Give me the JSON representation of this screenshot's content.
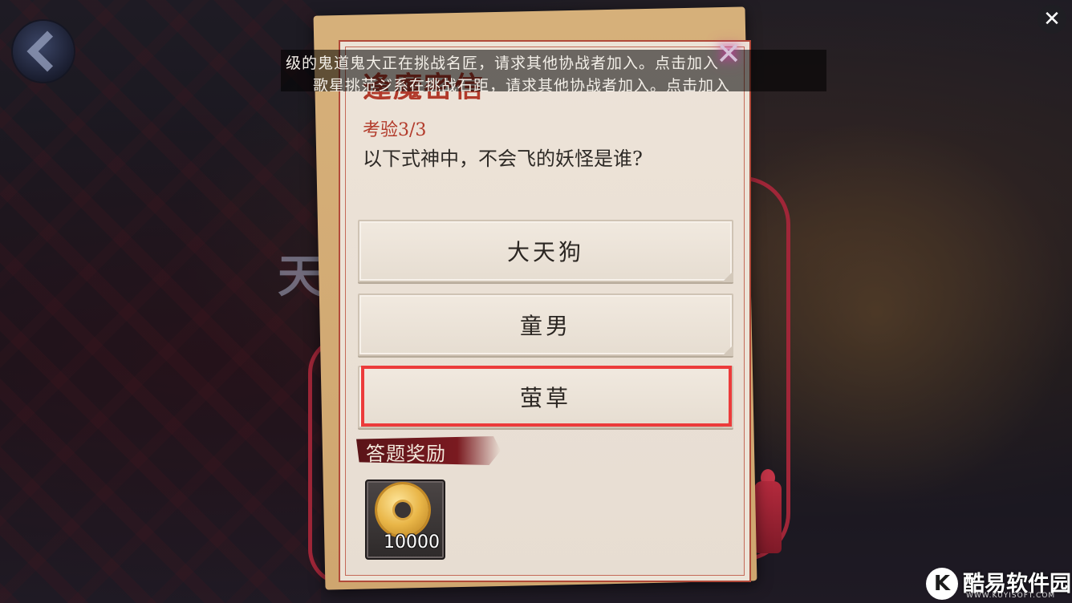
{
  "dialog": {
    "title": "逢魔密信",
    "round_label": "考验3/3",
    "question": "以下式神中，不会飞的妖怪是谁?",
    "options": [
      {
        "label": "大天狗"
      },
      {
        "label": "童男"
      },
      {
        "label": "萤草"
      }
    ],
    "highlighted_option_index": 2,
    "reward_section_label": "答题奖励",
    "reward": {
      "item_icon": "gold-coin-icon",
      "count": "10000"
    }
  },
  "notification": {
    "line1": "级的鬼道鬼大正在挑战名匠，请求其他协战者加入。点击加入",
    "line2": "歌星挑范ジ系在挑战石距，请求其他协战者加入。点击加入"
  },
  "watermark": {
    "badge": "K",
    "name": "酷易软件园",
    "url": "WWW.KUYISOFT.COM"
  },
  "icons": {
    "back": "back-arrow-icon",
    "close_screen": "close-icon",
    "close_dialog": "close-icon"
  },
  "colors": {
    "title_red": "#b13a2b",
    "highlight_red": "#ec3b3b",
    "rope_red": "#a02638",
    "paper": "#ede3d8"
  }
}
